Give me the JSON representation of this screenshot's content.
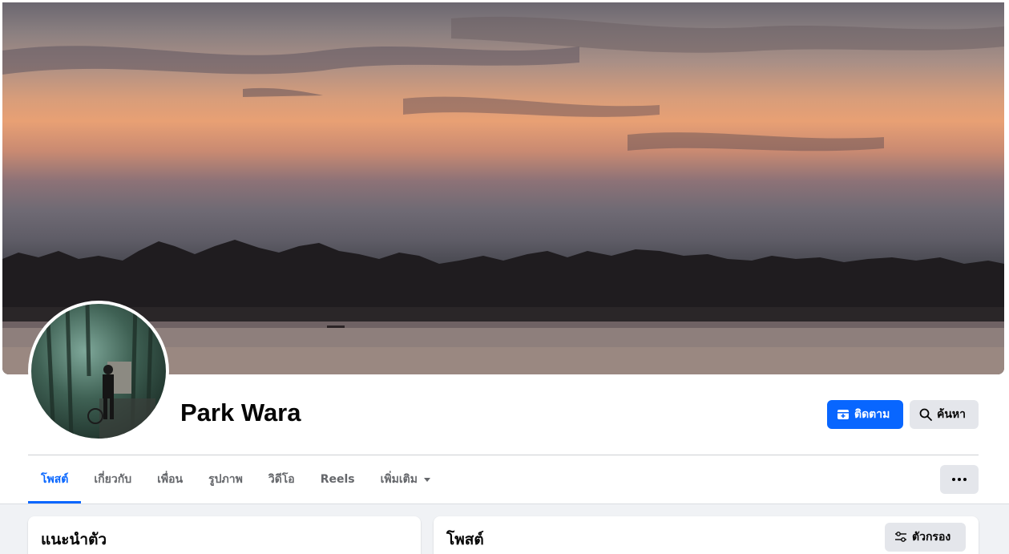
{
  "profile": {
    "name": "Park Wara"
  },
  "actions": {
    "follow_label": "ติดตาม",
    "search_label": "ค้นหา",
    "more_label": "•••"
  },
  "tabs": [
    {
      "label": "โพสต์",
      "active": true
    },
    {
      "label": "เกี่ยวกับ",
      "active": false
    },
    {
      "label": "เพื่อน",
      "active": false
    },
    {
      "label": "รูปภาพ",
      "active": false
    },
    {
      "label": "วิดีโอ",
      "active": false
    },
    {
      "label": "Reels",
      "active": false
    },
    {
      "label": "เพิ่มเติม",
      "active": false
    }
  ],
  "intro_card": {
    "title": "แนะนำตัว"
  },
  "posts_card": {
    "title": "โพสต์",
    "filter_label": "ตัวกรอง"
  },
  "icons": {
    "follow": "add-to-feed-icon",
    "search": "search-icon",
    "more": "more-options-icon",
    "filter": "filter-sliders-icon",
    "dropdown": "caret-down-icon"
  },
  "colors": {
    "accent": "#0866ff",
    "button_gray": "#e4e6eb",
    "feed_background": "#f0f2f5",
    "text_primary": "#050505",
    "text_secondary": "#65676b"
  }
}
